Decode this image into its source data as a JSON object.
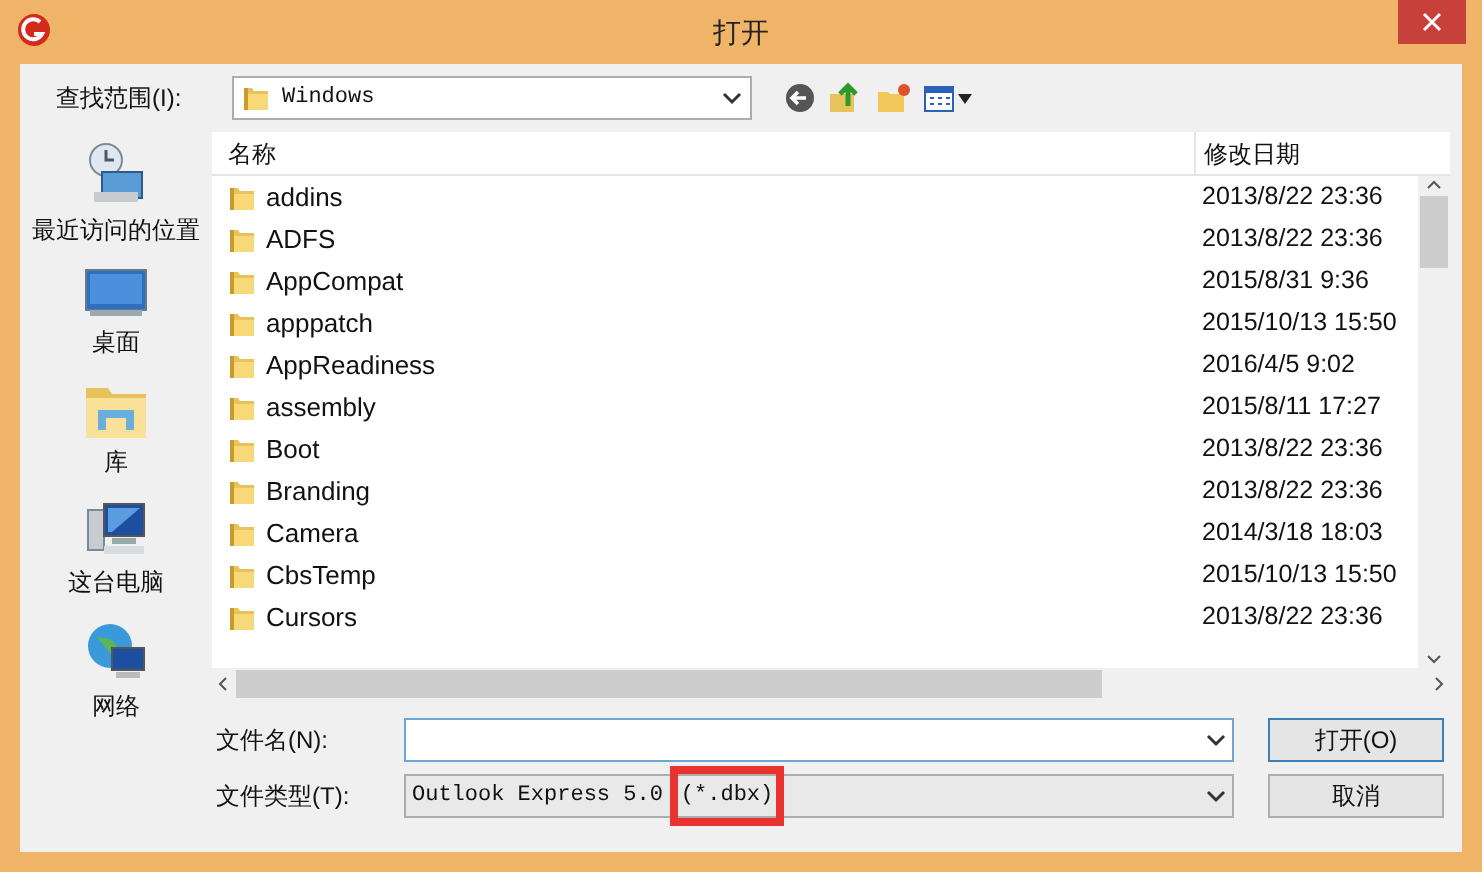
{
  "window": {
    "title": "打开"
  },
  "look_in": {
    "label": "查找范围(I):",
    "value": "Windows"
  },
  "places": [
    {
      "label": "最近访问的位置",
      "kind": "recent"
    },
    {
      "label": "桌面",
      "kind": "desktop"
    },
    {
      "label": "库",
      "kind": "library"
    },
    {
      "label": "这台电脑",
      "kind": "computer"
    },
    {
      "label": "网络",
      "kind": "network"
    }
  ],
  "table": {
    "columns": [
      "名称",
      "修改日期"
    ],
    "rows": [
      {
        "name": "addins",
        "modified": "2013/8/22 23:36"
      },
      {
        "name": "ADFS",
        "modified": "2013/8/22 23:36"
      },
      {
        "name": "AppCompat",
        "modified": "2015/8/31 9:36"
      },
      {
        "name": "apppatch",
        "modified": "2015/10/13 15:50"
      },
      {
        "name": "AppReadiness",
        "modified": "2016/4/5 9:02"
      },
      {
        "name": "assembly",
        "modified": "2015/8/11 17:27"
      },
      {
        "name": "Boot",
        "modified": "2013/8/22 23:36"
      },
      {
        "name": "Branding",
        "modified": "2013/8/22 23:36"
      },
      {
        "name": "Camera",
        "modified": "2014/3/18 18:03"
      },
      {
        "name": "CbsTemp",
        "modified": "2015/10/13 15:50"
      },
      {
        "name": "Cursors",
        "modified": "2013/8/22 23:36"
      }
    ]
  },
  "file_name": {
    "label": "文件名(N):"
  },
  "file_type": {
    "label": "文件类型(T):",
    "value": "Outlook Express 5.0",
    "highlighted": "(*.dbx)"
  },
  "buttons": [
    "打开(O)",
    "取消"
  ]
}
